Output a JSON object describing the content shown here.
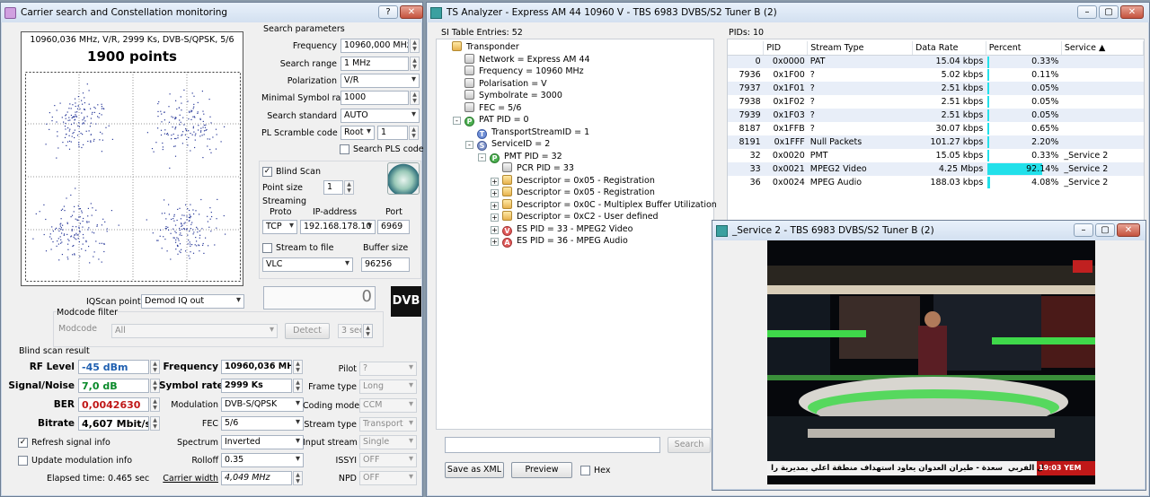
{
  "left": {
    "title": "Carrier search and Constellation monitoring",
    "help": "?",
    "constellation": {
      "info": "10960,036 MHz, V/R, 2999 Ks, DVB-S/QPSK, 5/6",
      "points": "1900 points"
    },
    "search": {
      "title": "Search parameters",
      "frequency_label": "Frequency",
      "frequency": "10960,000 MHz",
      "range_label": "Search range",
      "range": "1 MHz",
      "polar_label": "Polarization",
      "polar": "V/R",
      "msr_label": "Minimal Symbol rate",
      "msr": "1000",
      "std_label": "Search standard",
      "std": "AUTO",
      "pls_label": "PL Scramble code",
      "pls_mode": "Root",
      "pls_val": "1",
      "search_pls": "Search PLS code"
    },
    "blind": {
      "label": "Blind Scan",
      "point_size_label": "Point size",
      "point_size": "1",
      "streaming": "Streaming",
      "proto_label": "Proto",
      "ip_label": "IP-address",
      "port_label": "Port",
      "proto": "TCP",
      "ip": "192.168.178.10",
      "port": "6969",
      "stream_to_file": "Stream to file",
      "buffer_label": "Buffer size",
      "player": "VLC",
      "buffer": "96256"
    },
    "iq": {
      "label": "IQScan point",
      "value": "Demod IQ out",
      "counter": "0"
    },
    "modcode": {
      "title": "Modcode filter",
      "label": "Modcode",
      "value": "All",
      "detect": "Detect",
      "time": "3 sec"
    },
    "result": {
      "title": "Blind scan result",
      "rf_label": "RF Level",
      "rf": "-45 dBm",
      "sn_label": "Signal/Noise",
      "sn": "7,0 dB",
      "ber_label": "BER",
      "ber": "0,0042630",
      "bitrate_label": "Bitrate",
      "bitrate": "4,607 Mbit/s",
      "freq_label": "Frequency",
      "freq": "10960,036 MHz",
      "sr_label": "Symbol rate",
      "sr": "2999 Ks",
      "mod_label": "Modulation",
      "mod": "DVB-S/QPSK",
      "fec_label": "FEC",
      "fec": "5/6",
      "spec_label": "Spectrum",
      "spec": "Inverted",
      "roll_label": "Rolloff",
      "roll": "0.35",
      "cw_label": "Carrier width",
      "cw": "4,049 MHz",
      "pilot_label": "Pilot",
      "pilot": "?",
      "frame_label": "Frame type",
      "frame": "Long",
      "coding_label": "Coding mode",
      "coding": "CCM",
      "stype_label": "Stream type",
      "stype": "Transport",
      "istream_label": "Input stream",
      "istream": "Single",
      "issyi_label": "ISSYI",
      "issyi": "OFF",
      "npd_label": "NPD",
      "npd": "OFF",
      "refresh": "Refresh signal info",
      "update": "Update modulation info",
      "elapsed": "Elapsed time: 0.465 sec"
    },
    "logo": "DVB"
  },
  "ts": {
    "title": "TS Analyzer - Express AM 44 10960 V - TBS 6983 DVBS/S2 Tuner B (2)",
    "si_header": "SI Table Entries: 52",
    "pids_header": "PIDs: 10",
    "tree": [
      "Transponder",
      "Network = Express AM 44",
      "Frequency = 10960 MHz",
      "Polarisation = V",
      "Symbolrate = 3000",
      "FEC = 5/6",
      "PAT PID = 0",
      "TransportStreamID = 1",
      "ServiceID = 2",
      "PMT PID = 32",
      "PCR PID = 33",
      "Descriptor = 0x05 - Registration",
      "Descriptor = 0x05 - Registration",
      "Descriptor = 0x0C - Multiplex Buffer Utilization",
      "Descriptor = 0xC2 - User defined",
      "ES PID = 33 - MPEG2 Video",
      "ES PID = 36 - MPEG Audio"
    ],
    "columns": [
      "PID",
      "Stream Type",
      "Data Rate",
      "Percent",
      "Service"
    ],
    "rows": [
      {
        "pid": "0",
        "hex": "0x0000",
        "type": "PAT",
        "rate": "15.04 kbps",
        "pct": "0.33%",
        "svc": ""
      },
      {
        "pid": "7936",
        "hex": "0x1F00",
        "type": "?",
        "rate": "5.02 kbps",
        "pct": "0.11%",
        "svc": ""
      },
      {
        "pid": "7937",
        "hex": "0x1F01",
        "type": "?",
        "rate": "2.51 kbps",
        "pct": "0.05%",
        "svc": ""
      },
      {
        "pid": "7938",
        "hex": "0x1F02",
        "type": "?",
        "rate": "2.51 kbps",
        "pct": "0.05%",
        "svc": ""
      },
      {
        "pid": "7939",
        "hex": "0x1F03",
        "type": "?",
        "rate": "2.51 kbps",
        "pct": "0.05%",
        "svc": ""
      },
      {
        "pid": "8187",
        "hex": "0x1FFB",
        "type": "?",
        "rate": "30.07 kbps",
        "pct": "0.65%",
        "svc": ""
      },
      {
        "pid": "8191",
        "hex": "0x1FFF",
        "type": "Null Packets",
        "rate": "101.27 kbps",
        "pct": "2.20%",
        "svc": ""
      },
      {
        "pid": "32",
        "hex": "0x0020",
        "type": "PMT",
        "rate": "15.05 kbps",
        "pct": "0.33%",
        "svc": "_Service 2"
      },
      {
        "pid": "33",
        "hex": "0x0021",
        "type": "MPEG2 Video",
        "rate": "4.25 Mbps",
        "pct": "92.14%",
        "svc": "_Service 2"
      },
      {
        "pid": "36",
        "hex": "0x0024",
        "type": "MPEG Audio",
        "rate": "188.03 kbps",
        "pct": "4.08%",
        "svc": "_Service 2"
      }
    ],
    "pct_values": [
      0.33,
      0.11,
      0.05,
      0.05,
      0.05,
      0.65,
      2.2,
      0.33,
      92.14,
      4.08
    ],
    "search_btn": "Search",
    "save_xml": "Save as XML",
    "preview": "Preview",
    "hex": "Hex"
  },
  "video": {
    "title": "_Service 2 - TBS 6983 DVBS/S2 Tuner B (2)",
    "ticker": "سعدة - طيران العدوان يعاود استهداف منطقة أعلي بمديرية را",
    "ticker_left": "ل الفربي",
    "clock": "19:03 YEM"
  }
}
